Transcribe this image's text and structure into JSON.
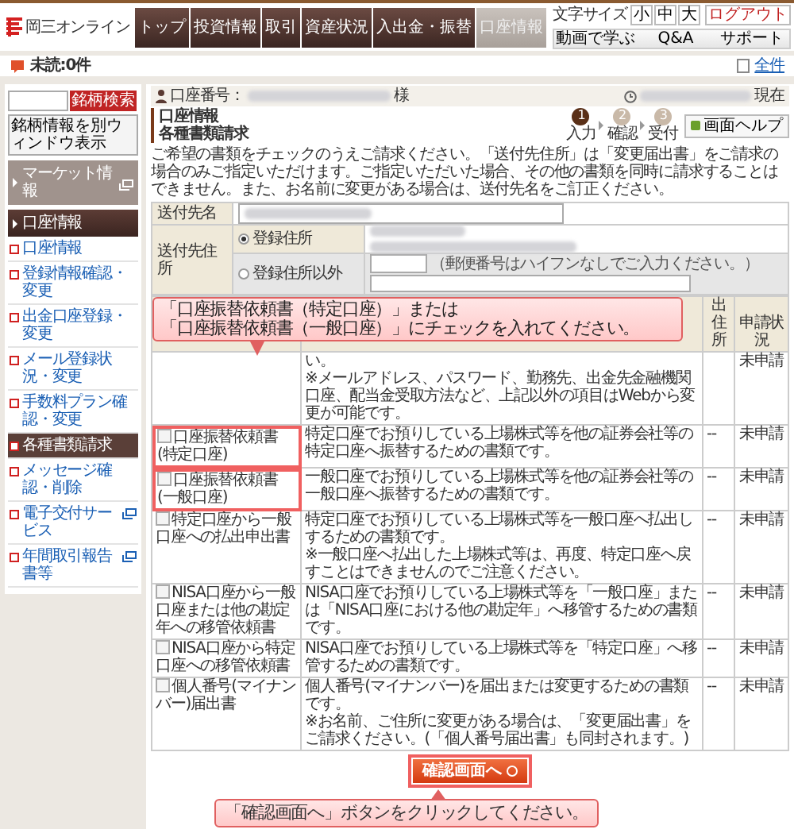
{
  "header": {
    "logo": "岡三オンライン",
    "nav": [
      {
        "label": "トップ",
        "selected": false
      },
      {
        "label": "投資情報",
        "selected": false
      },
      {
        "label": "取引",
        "selected": false
      },
      {
        "label": "資産状況",
        "selected": false
      },
      {
        "label": "入出金・振替",
        "selected": false
      },
      {
        "label": "口座情報",
        "selected": true
      }
    ],
    "font_size": {
      "label": "文字サイズ",
      "options": [
        {
          "label": "小",
          "selected": false
        },
        {
          "label": "中",
          "selected": false
        },
        {
          "label": "大",
          "selected": false
        }
      ]
    },
    "logout": "ログアウト",
    "links": [
      "動画で学ぶ",
      "Q&A",
      "サポート"
    ]
  },
  "notice_bar": {
    "unread": "未読:0件",
    "all": "全件"
  },
  "sidebar": {
    "search_button": "銘柄検索",
    "info_window": "銘柄情報を別ウィンドウ表示",
    "sections": [
      {
        "title": "マーケット情報",
        "expanded": false,
        "external": true
      },
      {
        "title": "口座情報",
        "expanded": true,
        "external": false
      }
    ],
    "items": [
      {
        "label": "口座情報",
        "selected": false,
        "external": false
      },
      {
        "label": "登録情報確認・変更",
        "selected": false,
        "external": false
      },
      {
        "label": "出金口座登録・変更",
        "selected": false,
        "external": false
      },
      {
        "label": "メール登録状況・変更",
        "selected": false,
        "external": false
      },
      {
        "label": "手数料プラン確認・変更",
        "selected": false,
        "external": false
      },
      {
        "label": "各種書類請求",
        "selected": true,
        "external": false
      },
      {
        "label": "メッセージ確認・削除",
        "selected": false,
        "external": false
      },
      {
        "label": "電子交付サービス",
        "selected": false,
        "external": true
      },
      {
        "label": "年間取引報告書等",
        "selected": false,
        "external": true
      }
    ]
  },
  "main": {
    "account_label": "口座番号：",
    "account_suffix": "様",
    "as_of": "現在",
    "breadcrumb": "口座情報",
    "title": "各種書類請求",
    "steps": [
      {
        "number": "1",
        "label": "入力",
        "selected": true
      },
      {
        "number": "2",
        "label": "確認",
        "selected": false
      },
      {
        "number": "3",
        "label": "受付",
        "selected": false
      }
    ],
    "help": "画面ヘルプ",
    "intro": "ご希望の書類をチェックのうえご請求ください。「送付先住所」は「変更届出書」をご請求の場合のみご指定いただけます。ご指定いただいた場合、その他の書類を同時に請求することはできません。また、お名前に変更がある場合は、送付先名をご訂正ください。",
    "form": {
      "name_label": "送付先名",
      "address_label": "送付先住所",
      "address_options": [
        {
          "label": "登録住所",
          "selected": true
        },
        {
          "label": "登録住所以外",
          "selected": false
        }
      ],
      "postal_hint": "（郵便番号はハイフンなしでご入力ください。）"
    },
    "callout": [
      "「口座振替依頼書（特定口座）」または",
      "「口座振替依頼書（一般口座）」にチェックを入れてください。"
    ],
    "table": {
      "columns": [
        "出住所",
        "申請状況"
      ],
      "rows": [
        {
          "description": [
            "い。",
            "※メールアドレス、パスワード、勤務先、出金先金融機関口座、配当金受取方法など、上記以外の項目はWebから変更が可能です。"
          ],
          "status": "未申請"
        },
        {
          "name": "口座振替依頼書(特定口座)",
          "checked": false,
          "highlighted": true,
          "description": [
            "特定口座でお預りしている上場株式等を他の証券会社等の特定口座へ振替するための書類です。"
          ],
          "address": "--",
          "status": "未申請"
        },
        {
          "name": "口座振替依頼書(一般口座)",
          "checked": false,
          "highlighted": true,
          "description": [
            "一般口座でお預りしている上場株式等を他の証券会社等の一般口座へ振替するための書類です。"
          ],
          "address": "--",
          "status": "未申請"
        },
        {
          "name": "特定口座から一般口座への払出申出書",
          "checked": false,
          "highlighted": false,
          "description": [
            "特定口座でお預りしている上場株式等を一般口座へ払出しするための書類です。",
            "※一般口座へ払出した上場株式等は、再度、特定口座へ戻すことはできませんのでご注意ください。"
          ],
          "address": "--",
          "status": "未申請"
        },
        {
          "name": "NISA口座から一般口座または他の勘定年への移管依頼書",
          "checked": false,
          "highlighted": false,
          "description": [
            "NISA口座でお預りしている上場株式等を「一般口座」または「NISA口座における他の勘定年」へ移管するための書類です。"
          ],
          "address": "--",
          "status": "未申請"
        },
        {
          "name": "NISA口座から特定口座への移管依頼書",
          "checked": false,
          "highlighted": false,
          "description": [
            "NISA口座でお預りしている上場株式等を「特定口座」へ移管するための書類です。"
          ],
          "address": "--",
          "status": "未申請"
        },
        {
          "name": "個人番号(マイナンバー)届出書",
          "checked": false,
          "highlighted": false,
          "description": [
            "個人番号(マイナンバー)を届出または変更するための書類です。",
            "※お名前、ご住所に変更がある場合は、「変更届出書」をご請求ください。(「個人番号届出書」も同封されます。)"
          ],
          "address": "--",
          "status": "未申請"
        }
      ]
    },
    "submit": "確認画面へ",
    "submit_callout": "「確認画面へ」ボタンをクリックしてください。"
  }
}
